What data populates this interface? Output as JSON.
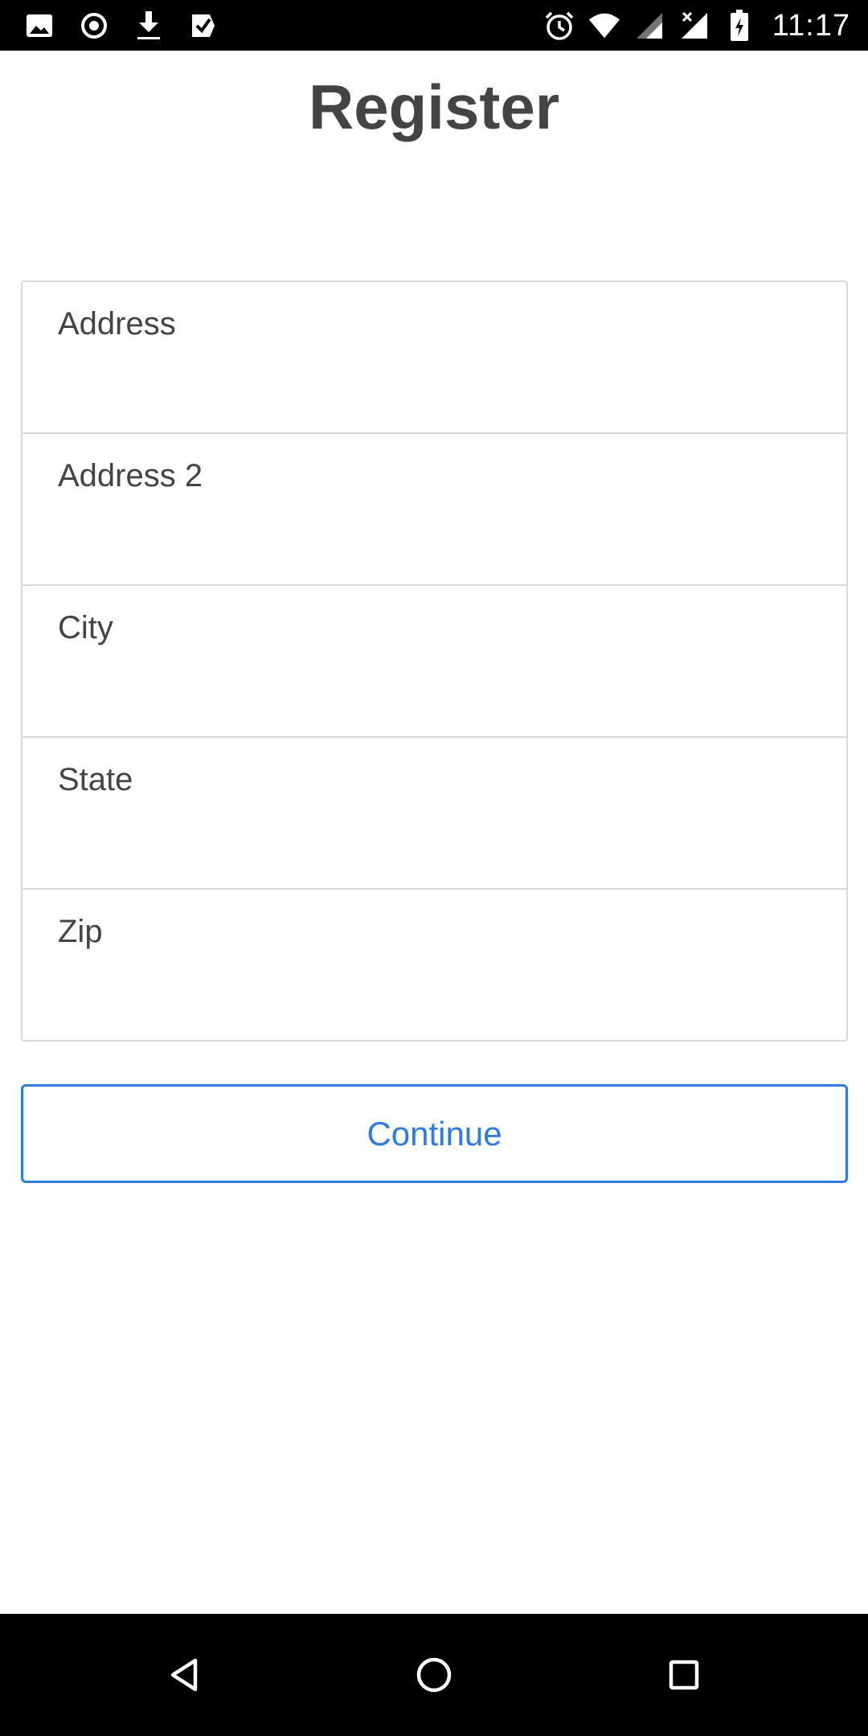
{
  "status_bar": {
    "time": "11:17",
    "left_icons": [
      "image-icon",
      "record-icon",
      "download-icon",
      "task-icon"
    ],
    "right_icons": [
      "alarm-icon",
      "wifi-icon",
      "signal-icon",
      "signal-no-data-icon",
      "battery-charging-icon"
    ]
  },
  "header": {
    "title": "Register"
  },
  "form": {
    "fields": [
      {
        "label": "Address",
        "value": ""
      },
      {
        "label": "Address 2",
        "value": ""
      },
      {
        "label": "City",
        "value": ""
      },
      {
        "label": "State",
        "value": ""
      },
      {
        "label": "Zip",
        "value": ""
      }
    ],
    "continue_label": "Continue"
  },
  "nav_bar": {
    "buttons": [
      "back-icon",
      "home-icon",
      "recents-icon"
    ]
  },
  "colors": {
    "accent": "#2e7be4",
    "title": "#444444",
    "border": "#d9d9d9",
    "bars": "#000000"
  }
}
